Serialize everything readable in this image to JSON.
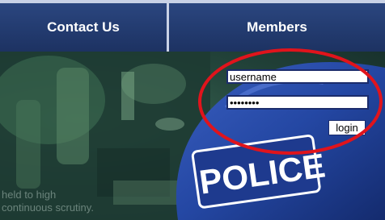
{
  "nav": {
    "items": [
      {
        "label": "Contact Us"
      },
      {
        "label": "Members"
      }
    ]
  },
  "login": {
    "username_value": "username",
    "password_value": "password",
    "button_label": "login"
  },
  "hero": {
    "tagline_line1": "held to high",
    "tagline_line2": "continuous scrutiny."
  },
  "badge": {
    "text": "POLICE"
  },
  "colors": {
    "nav_bg": "#223a6e",
    "nav_divider": "#c9d2e6",
    "field_border": "#1b2c6c",
    "highlight": "#e0141c"
  }
}
